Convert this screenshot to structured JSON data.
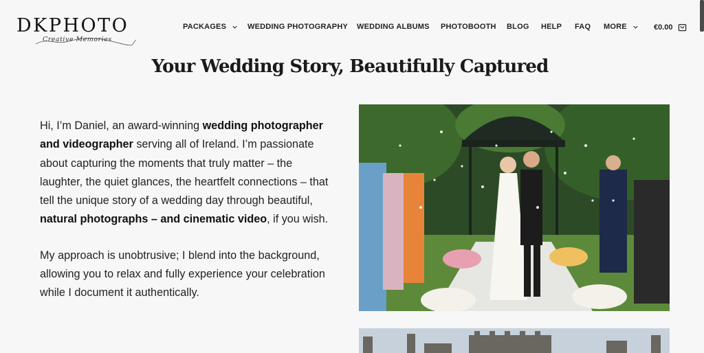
{
  "brand": {
    "name": "DKPHOTO",
    "tagline": "Creative Memories"
  },
  "nav": {
    "items": [
      {
        "label": "PACKAGES",
        "dropdown": true
      },
      {
        "label": "WEDDING PHOTOGRAPHY",
        "dropdown": false
      },
      {
        "label": "WEDDING ALBUMS",
        "dropdown": false
      },
      {
        "label": "PHOTOBOOTH",
        "dropdown": false
      },
      {
        "label": "BLOG",
        "dropdown": false
      },
      {
        "label": "HELP",
        "dropdown": false
      },
      {
        "label": "FAQ",
        "dropdown": false
      },
      {
        "label": "MORE",
        "dropdown": true
      }
    ],
    "cart_total": "€0.00",
    "cart_icon": "shopping-bag-icon"
  },
  "hero": {
    "title": "Your Wedding Story, Beautifully Captured"
  },
  "intro": {
    "p1_a": "Hi, I’m Daniel, an award-winning ",
    "p1_b": "wedding photographer and videographer",
    "p1_c": " serving all of Ireland. I’m passionate about capturing the moments that truly matter – the laughter, the quiet glances, the heartfelt connections – that tell the unique story of a wedding day through beautiful, ",
    "p1_d": "natural photographs – and cinematic video",
    "p1_e": ", if you wish.",
    "p2": "My approach is unobtrusive; I blend into the background, allowing you to relax and fully experience your celebration while I document it authentically."
  },
  "colors": {
    "background": "#f7f7f7",
    "text": "#222222",
    "foliage": "#2f4a28"
  }
}
